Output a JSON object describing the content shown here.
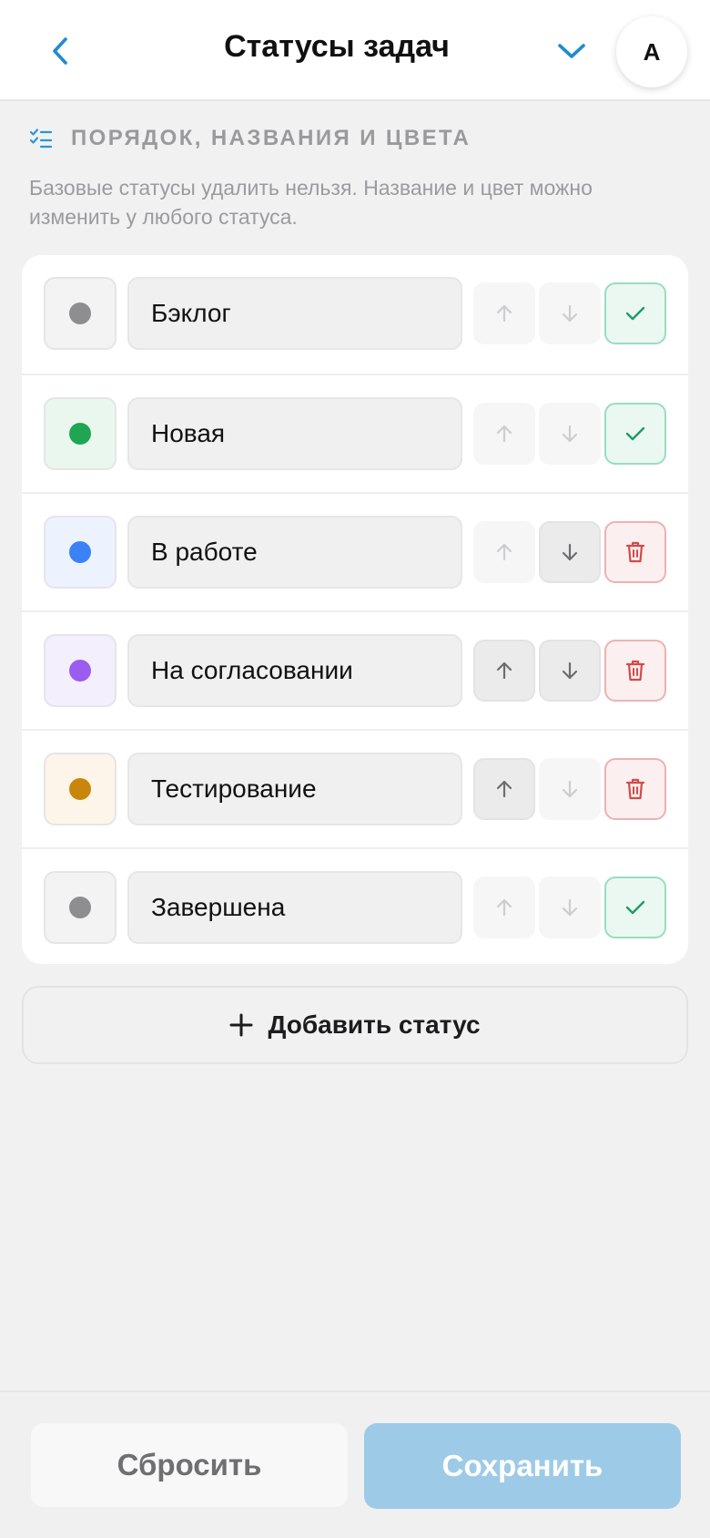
{
  "header": {
    "title": "Статусы задач",
    "avatar_letter": "А",
    "accent": "#1f8bd1"
  },
  "section": {
    "title": "ПОРЯДОК, НАЗВАНИЯ И ЦВЕТА",
    "description": "Базовые статусы удалить нельзя. Название и цвет можно изменить у любого статуса."
  },
  "statuses": [
    {
      "name": "Бэклог",
      "color": "#8e8e91",
      "swatch_bg": "#f3f3f4",
      "up_enabled": false,
      "down_enabled": false,
      "action": "check"
    },
    {
      "name": "Новая",
      "color": "#1fa653",
      "swatch_bg": "#eaf7ee",
      "up_enabled": false,
      "down_enabled": false,
      "action": "check"
    },
    {
      "name": "В работе",
      "color": "#3b82f6",
      "swatch_bg": "#edf3fe",
      "up_enabled": false,
      "down_enabled": true,
      "action": "delete"
    },
    {
      "name": "На согласовании",
      "color": "#9b5cf0",
      "swatch_bg": "#f4effd",
      "up_enabled": true,
      "down_enabled": true,
      "action": "delete"
    },
    {
      "name": "Тестирование",
      "color": "#c8860d",
      "swatch_bg": "#fdf4ea",
      "up_enabled": true,
      "down_enabled": false,
      "action": "delete"
    },
    {
      "name": "Завершена",
      "color": "#8e8e91",
      "swatch_bg": "#f3f3f4",
      "up_enabled": false,
      "down_enabled": false,
      "action": "check"
    }
  ],
  "add_button": {
    "label": "Добавить статус"
  },
  "footer": {
    "reset_label": "Сбросить",
    "save_label": "Сохранить"
  },
  "colors": {
    "check": "#1f9a6a",
    "delete": "#d24b4b",
    "arrow_enabled": "#6d6d70",
    "arrow_disabled": "#cdcdd0"
  }
}
